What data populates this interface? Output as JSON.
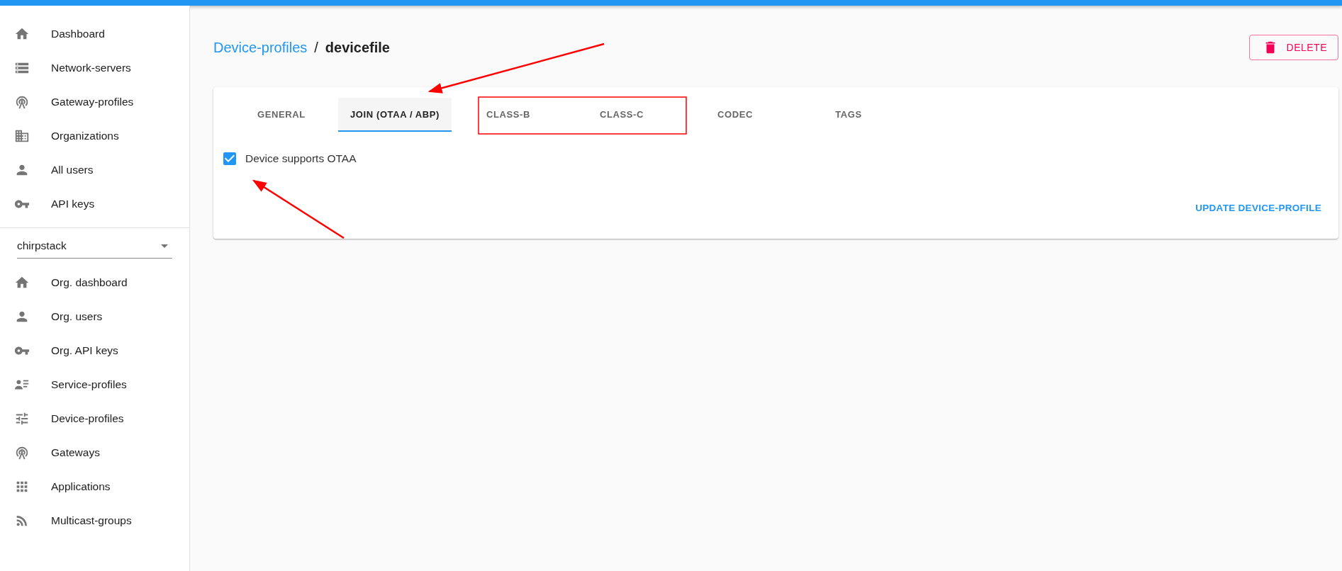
{
  "sidebar": {
    "items": [
      {
        "label": "Dashboard"
      },
      {
        "label": "Network-servers"
      },
      {
        "label": "Gateway-profiles"
      },
      {
        "label": "Organizations"
      },
      {
        "label": "All users"
      },
      {
        "label": "API keys"
      }
    ],
    "organization_select": {
      "value": "chirpstack"
    },
    "org_items": [
      {
        "label": "Org. dashboard"
      },
      {
        "label": "Org. users"
      },
      {
        "label": "Org. API keys"
      },
      {
        "label": "Service-profiles"
      },
      {
        "label": "Device-profiles"
      },
      {
        "label": "Gateways"
      },
      {
        "label": "Applications"
      },
      {
        "label": "Multicast-groups"
      }
    ]
  },
  "breadcrumb": {
    "parent": "Device-profiles",
    "separator": "/",
    "current": "devicefile"
  },
  "delete_button": "DELETE",
  "tabs": [
    {
      "label": "GENERAL",
      "selected": false
    },
    {
      "label": "JOIN (OTAA / ABP)",
      "selected": true
    },
    {
      "label": "CLASS-B",
      "selected": false
    },
    {
      "label": "CLASS-C",
      "selected": false
    },
    {
      "label": "CODEC",
      "selected": false
    },
    {
      "label": "TAGS",
      "selected": false
    }
  ],
  "otaa_checkbox": {
    "label": "Device supports OTAA",
    "checked": true
  },
  "submit_button": "UPDATE DEVICE-PROFILE"
}
